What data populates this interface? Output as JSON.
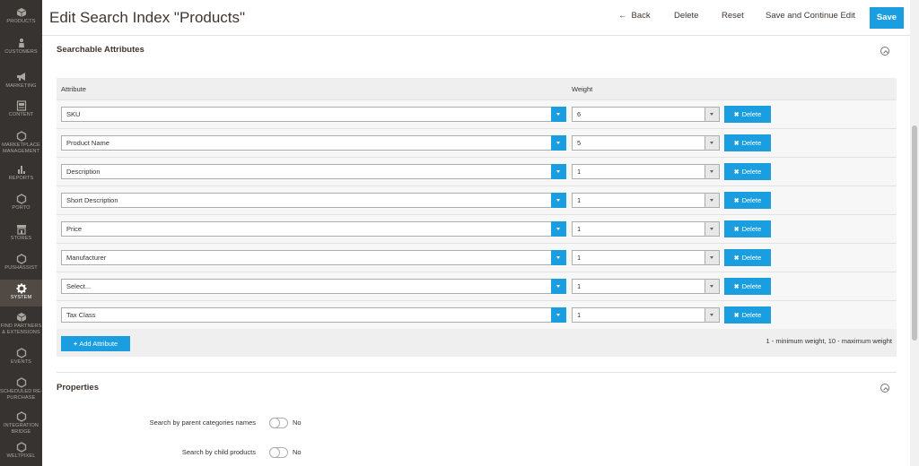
{
  "sidebar": {
    "items": [
      {
        "label": "Products",
        "icon": "cube-icon"
      },
      {
        "label": "Customers",
        "icon": "person-icon"
      },
      {
        "label": "Marketing",
        "icon": "megaphone-icon"
      },
      {
        "label": "Content",
        "icon": "content-icon"
      },
      {
        "label": "Marketplace Management",
        "icon": "hexagon-icon"
      },
      {
        "label": "Reports",
        "icon": "bar-chart-icon"
      },
      {
        "label": "Porto",
        "icon": "hexagon-icon"
      },
      {
        "label": "Stores",
        "icon": "store-icon"
      },
      {
        "label": "Pushassist",
        "icon": "hexagon-icon"
      },
      {
        "label": "System",
        "icon": "gear-icon"
      },
      {
        "label": "Find Partners & Extensions",
        "icon": "cube-icon"
      },
      {
        "label": "Events",
        "icon": "hexagon-icon"
      },
      {
        "label": "Scheduled Re-Purchase",
        "icon": "hexagon-icon"
      },
      {
        "label": "Integration Bridge",
        "icon": "hexagon-icon"
      },
      {
        "label": "Weltpixel",
        "icon": "hexagon-icon"
      }
    ],
    "active_index": 9
  },
  "header": {
    "title": "Edit Search Index \"Products\"",
    "back_label": "Back",
    "delete_label": "Delete",
    "reset_label": "Reset",
    "save_continue_label": "Save and Continue Edit",
    "save_label": "Save"
  },
  "searchable": {
    "title": "Searchable Attributes",
    "col_attribute": "Attribute",
    "col_weight": "Weight",
    "rows": [
      {
        "attribute": "SKU",
        "weight": "6"
      },
      {
        "attribute": "Product Name",
        "weight": "5"
      },
      {
        "attribute": "Description",
        "weight": "1"
      },
      {
        "attribute": "Short Description",
        "weight": "1"
      },
      {
        "attribute": "Price",
        "weight": "1"
      },
      {
        "attribute": "Manufacturer",
        "weight": "1"
      },
      {
        "attribute": "Select...",
        "weight": "1"
      },
      {
        "attribute": "Tax Class",
        "weight": "1"
      }
    ],
    "delete_label": "Delete",
    "add_label": "Add Attribute",
    "weight_note": "1 - minimum weight, 10 - maximum weight"
  },
  "properties": {
    "title": "Properties",
    "items": [
      {
        "label": "Search by parent categories names",
        "value": "No"
      },
      {
        "label": "Search by child products",
        "value": "No"
      }
    ]
  },
  "colors": {
    "accent": "#1a9ee0",
    "sidebar_bg": "#373330",
    "sidebar_active": "#514943"
  }
}
